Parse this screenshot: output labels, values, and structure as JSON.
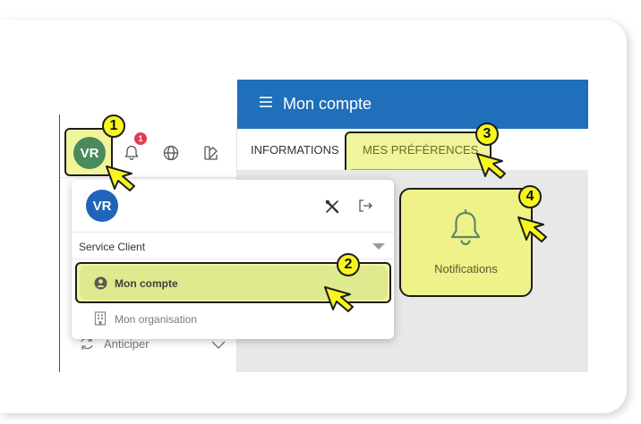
{
  "header": {
    "title": "Mon compte",
    "menu_icon": "hamburger-icon"
  },
  "user": {
    "initials": "VR",
    "notification_count": "1"
  },
  "tabs": [
    {
      "label": "INFORMATIONS",
      "active": false
    },
    {
      "label": "MES PRÉFÉRENCES",
      "active": true
    }
  ],
  "preferences": {
    "notifications_label": "Notifications"
  },
  "dropdown": {
    "service": "Service Client",
    "items": [
      {
        "label": "Mon compte",
        "icon": "user-circle-icon",
        "selected": true
      },
      {
        "label": "Mon organisation",
        "icon": "building-icon",
        "selected": false
      }
    ]
  },
  "sidebar": {
    "items": [
      {
        "label": "Anticiper",
        "icon": "refresh-icon"
      }
    ]
  },
  "callouts": [
    "1",
    "2",
    "3",
    "4"
  ],
  "colors": {
    "header_blue": "#1f6fba",
    "avatar_green": "#4a8a5c",
    "avatar_blue": "#1f64b8",
    "highlight_yellow": "#f0f49a",
    "callout_yellow": "#f7f51e",
    "badge_red": "#e53950"
  }
}
